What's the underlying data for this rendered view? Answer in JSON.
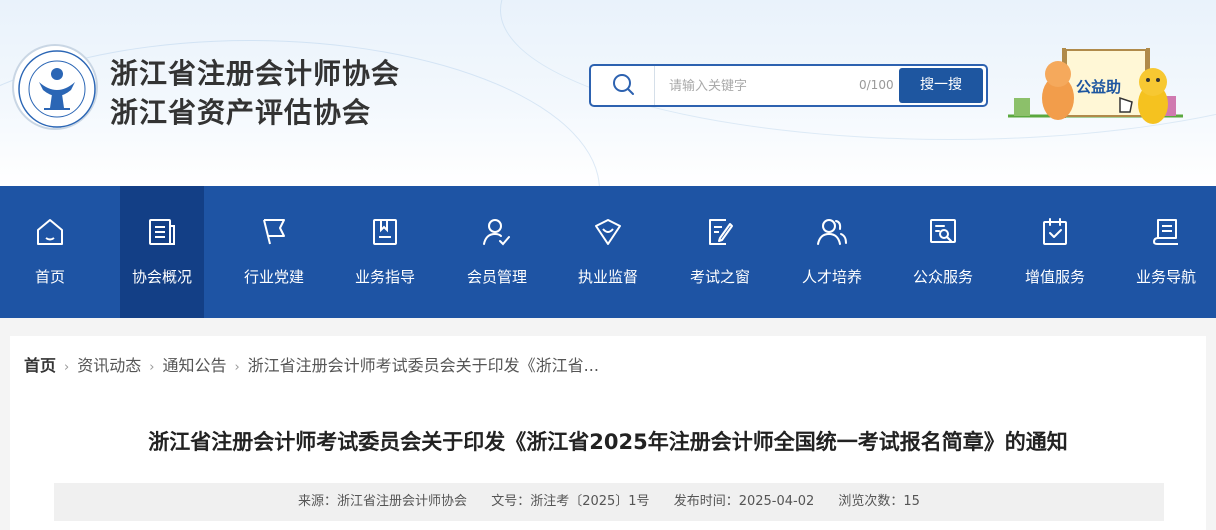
{
  "header": {
    "org_name_1": "浙江省注册会计师协会",
    "org_name_2": "浙江省资产评估协会",
    "logo_text": "浙江省注册会计师协会",
    "search": {
      "placeholder": "请输入关键字",
      "counter": "0/100",
      "button_label": "搜一搜"
    },
    "mascot_text": "公益助"
  },
  "nav": {
    "items": [
      {
        "label": "首页",
        "icon": "home-icon"
      },
      {
        "label": "协会概况",
        "icon": "document-icon"
      },
      {
        "label": "行业党建",
        "icon": "flag-icon"
      },
      {
        "label": "业务指导",
        "icon": "bookmark-book-icon"
      },
      {
        "label": "会员管理",
        "icon": "user-check-icon"
      },
      {
        "label": "执业监督",
        "icon": "shield-heart-icon"
      },
      {
        "label": "考试之窗",
        "icon": "edit-document-icon"
      },
      {
        "label": "人才培养",
        "icon": "users-icon"
      },
      {
        "label": "公众服务",
        "icon": "search-document-icon"
      },
      {
        "label": "增值服务",
        "icon": "clipboard-check-icon"
      },
      {
        "label": "业务导航",
        "icon": "notebook-icon"
      }
    ],
    "active_index": 1
  },
  "breadcrumb": {
    "home": "首页",
    "level1": "资讯动态",
    "level2": "通知公告",
    "current": "浙江省注册会计师考试委员会关于印发《浙江省..."
  },
  "article": {
    "title": "浙江省注册会计师考试委员会关于印发《浙江省2025年注册会计师全国统一考试报名简章》的通知",
    "source": "来源：浙江省注册会计师协会",
    "doc_no": "文号：浙注考〔2025〕1号",
    "publish_time": "发布时间：2025-04-02",
    "views": "浏览次数：15"
  },
  "colors": {
    "nav_bg": "#1e54a4",
    "nav_active": "#133f86",
    "brand_blue": "#1e56a0"
  }
}
